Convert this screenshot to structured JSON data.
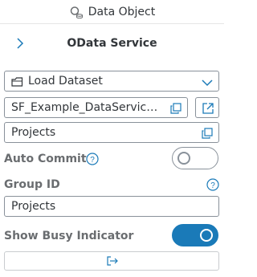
{
  "header": {
    "title": "Data Object",
    "icon": "search-database-icon"
  },
  "service": {
    "title": "OData Service",
    "chevron": "chevron-right-icon"
  },
  "operation": {
    "value": "Load Dataset",
    "icon": "load-dataset-icon",
    "dropdown_icon": "chevron-down-icon"
  },
  "service_path": {
    "value": "SF_Example_DataServices...",
    "icon": "copy-icon",
    "export_icon": "open-external-icon"
  },
  "entity_set": {
    "value": "Projects",
    "icon": "copy-icon"
  },
  "auto_commit": {
    "label": "Auto Commit",
    "help_icon": "help-icon",
    "enabled": false
  },
  "group_id": {
    "label": "Group ID",
    "help_icon": "help-icon",
    "value": "Projects"
  },
  "busy_indicator": {
    "label": "Show Busy Indicator",
    "enabled": true
  },
  "footer": {
    "icon": "sign-out-icon"
  },
  "colors": {
    "accent": "#1a7ab8",
    "text": "#32363a",
    "label": "#6a6d70",
    "border": "#89919a"
  }
}
